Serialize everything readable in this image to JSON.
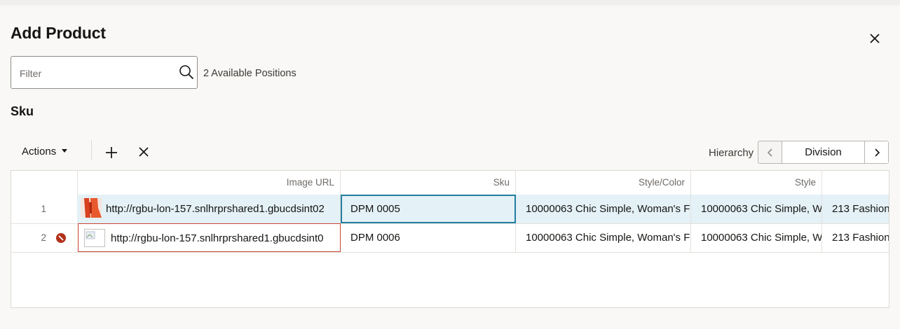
{
  "dialog": {
    "title": "Add Product",
    "close_icon": "close-icon"
  },
  "filter": {
    "placeholder": "Filter",
    "value": "",
    "available_text": "2 Available Positions"
  },
  "section_title": "Sku",
  "toolbar": {
    "actions_label": "Actions",
    "add_icon": "plus-icon",
    "delete_icon": "x-icon",
    "hierarchy_label": "Hierarchy",
    "hierarchy_value": "Division"
  },
  "table": {
    "columns": [
      "Image URL",
      "Sku",
      "Style/Color",
      "Style",
      ""
    ],
    "rows": [
      {
        "num": "1",
        "image_url": "http://rgbu-lon-157.snlhrprshared1.gbucdsint02",
        "sku": "DPM 0005",
        "style_color": "10000063 Chic Simple, Woman's F",
        "style": "10000063 Chic Simple, W",
        "extra": "213 Fashion"
      },
      {
        "num": "2",
        "image_url": "http://rgbu-lon-157.snlhrprshared1.gbucdsint0",
        "sku": "DPM 0006",
        "style_color": "10000063 Chic Simple, Woman's F",
        "style": "10000063 Chic Simple, W",
        "extra": "213 Fashion"
      }
    ]
  },
  "colors": {
    "selected_row": "#e4f1f7",
    "focus_border": "#227e9e",
    "error": "#b3311a"
  }
}
